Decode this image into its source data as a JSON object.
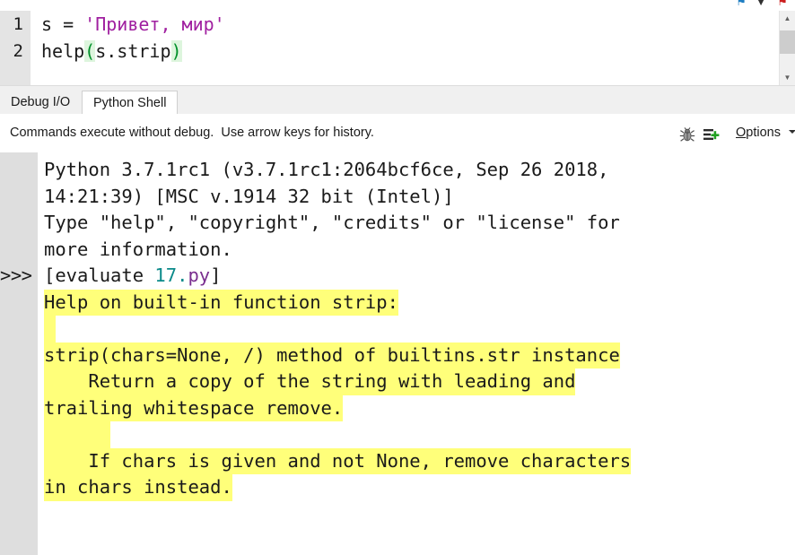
{
  "toolbar_top": {
    "icons": [
      {
        "name": "pin-icon",
        "glyph": "⚑"
      },
      {
        "name": "caret-icon",
        "glyph": "▼"
      },
      {
        "name": "flag-icon",
        "glyph": "⚑"
      }
    ]
  },
  "editor": {
    "lines": [
      {
        "number": "1",
        "segments": [
          {
            "text": "s = ",
            "kind": "plain"
          },
          {
            "text": "'Привет, мир'",
            "kind": "string"
          }
        ]
      },
      {
        "number": "2",
        "segments": [
          {
            "text": "help",
            "kind": "plain"
          },
          {
            "text": "(",
            "kind": "paren"
          },
          {
            "text": "s.strip",
            "kind": "plain"
          },
          {
            "text": ")",
            "kind": "paren"
          }
        ]
      }
    ],
    "scrollbar": {
      "up_glyph": "▲",
      "down_glyph": "▼"
    }
  },
  "tabs": [
    {
      "label": "Debug I/O",
      "active": false
    },
    {
      "label": "Python Shell",
      "active": true
    }
  ],
  "hintbar": {
    "hint": "Commands execute without debug.  Use arrow keys for history.",
    "bug_icon": "bug-icon",
    "add_line_icon": "add-line-icon",
    "options_accel": "O",
    "options_rest": "ptions"
  },
  "shell": {
    "lines": [
      {
        "prompt": "",
        "segments": [
          {
            "text": "Python 3.7.1rc1 (v3.7.1rc1:2064bcf6ce, Sep 26 2018,",
            "kind": "plain"
          }
        ]
      },
      {
        "prompt": "",
        "segments": [
          {
            "text": "14:21:39) [MSC v.1914 32 bit (Intel)]",
            "kind": "plain"
          }
        ]
      },
      {
        "prompt": "",
        "segments": [
          {
            "text": "Type \"help\", \"copyright\", \"credits\" or \"license\" for",
            "kind": "plain"
          }
        ]
      },
      {
        "prompt": "",
        "segments": [
          {
            "text": "more information.",
            "kind": "plain"
          }
        ]
      },
      {
        "prompt": ">>>",
        "segments": [
          {
            "text": "[evaluate ",
            "kind": "plain"
          },
          {
            "text": "17.",
            "kind": "number"
          },
          {
            "text": "py",
            "kind": "module"
          },
          {
            "text": "]",
            "kind": "plain"
          }
        ]
      },
      {
        "prompt": "",
        "segments": [
          {
            "text": "Help on built-in function strip:",
            "kind": "highlight"
          }
        ]
      },
      {
        "prompt": "",
        "blank_highlight_width": 13,
        "segments": []
      },
      {
        "prompt": "",
        "segments": [
          {
            "text": "strip(chars=None, /) method of builtins.str instance",
            "kind": "highlight"
          }
        ]
      },
      {
        "prompt": "",
        "segments": [
          {
            "text": "    Return a copy of the string with leading and",
            "kind": "highlight"
          }
        ]
      },
      {
        "prompt": "",
        "segments": [
          {
            "text": "trailing whitespace remove.",
            "kind": "highlight"
          }
        ]
      },
      {
        "prompt": "",
        "blank_highlight_width": 74,
        "segments": []
      },
      {
        "prompt": "",
        "segments": [
          {
            "text": "    If chars is given and not None, remove characters",
            "kind": "highlight"
          }
        ]
      },
      {
        "prompt": "",
        "segments": [
          {
            "text": "in chars instead.",
            "kind": "highlight"
          }
        ]
      }
    ]
  },
  "colors": {
    "highlight": "#ffff7a",
    "gutter": "#dedede",
    "string": "#a020a0",
    "paren": "#00902a",
    "number": "#0b8a8a",
    "module": "#7a2f8f"
  }
}
